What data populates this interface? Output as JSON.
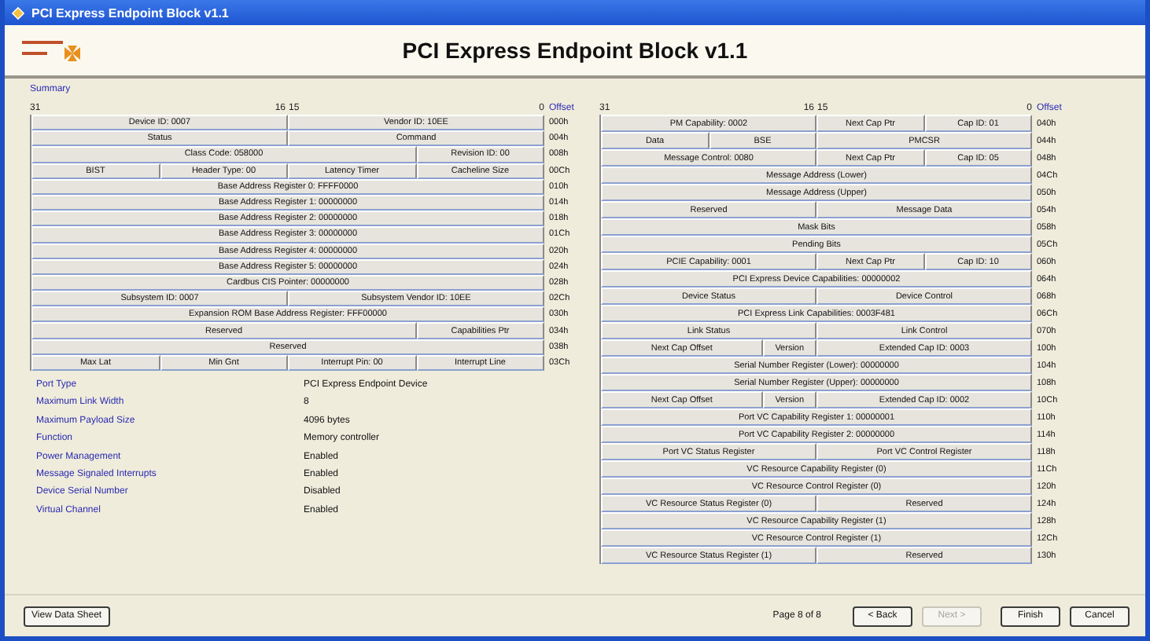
{
  "window": {
    "title": "PCI Express Endpoint Block v1.1"
  },
  "heading": "PCI Express Endpoint Block v1.1",
  "section_label": "Summary",
  "left_table": {
    "bit_headers": [
      "31",
      "16",
      "15",
      "0"
    ],
    "offset_header": "Offset",
    "rows": [
      {
        "offset": "000h",
        "cells": [
          {
            "label": "Device ID: 0007",
            "kind": "half"
          },
          {
            "label": "Vendor ID: 10EE",
            "kind": "half"
          }
        ]
      },
      {
        "offset": "004h",
        "cells": [
          {
            "label": "Status",
            "kind": "half"
          },
          {
            "label": "Command",
            "kind": "half"
          }
        ]
      },
      {
        "offset": "008h",
        "cells": [
          {
            "label": "Class Code: 058000",
            "kind": "triple"
          },
          {
            "label": "Revision ID: 00",
            "kind": "byte"
          }
        ]
      },
      {
        "offset": "00Ch",
        "cells": [
          {
            "label": "BIST",
            "kind": "byte"
          },
          {
            "label": "Header Type: 00",
            "kind": "byte"
          },
          {
            "label": "Latency Timer",
            "kind": "byte"
          },
          {
            "label": "Cacheline Size",
            "kind": "byte"
          }
        ]
      },
      {
        "offset": "010h",
        "cells": [
          {
            "label": "Base Address Register 0: FFFF0000",
            "kind": "word"
          }
        ]
      },
      {
        "offset": "014h",
        "cells": [
          {
            "label": "Base Address Register 1: 00000000",
            "kind": "word"
          }
        ]
      },
      {
        "offset": "018h",
        "cells": [
          {
            "label": "Base Address Register 2: 00000000",
            "kind": "word"
          }
        ]
      },
      {
        "offset": "01Ch",
        "cells": [
          {
            "label": "Base Address Register 3: 00000000",
            "kind": "word"
          }
        ]
      },
      {
        "offset": "020h",
        "cells": [
          {
            "label": "Base Address Register 4: 00000000",
            "kind": "word"
          }
        ]
      },
      {
        "offset": "024h",
        "cells": [
          {
            "label": "Base Address Register 5: 00000000",
            "kind": "word"
          }
        ]
      },
      {
        "offset": "028h",
        "cells": [
          {
            "label": "Cardbus CIS Pointer: 00000000",
            "kind": "word"
          }
        ]
      },
      {
        "offset": "02Ch",
        "cells": [
          {
            "label": "Subsystem ID: 0007",
            "kind": "half"
          },
          {
            "label": "Subsystem Vendor ID: 10EE",
            "kind": "half"
          }
        ]
      },
      {
        "offset": "030h",
        "cells": [
          {
            "label": "Expansion ROM Base Address Register: FFF00000",
            "kind": "word"
          }
        ]
      },
      {
        "offset": "034h",
        "cells": [
          {
            "label": "Reserved",
            "kind": "triple"
          },
          {
            "label": "Capabilities Ptr",
            "kind": "byte"
          }
        ]
      },
      {
        "offset": "038h",
        "cells": [
          {
            "label": "Reserved",
            "kind": "word"
          }
        ]
      },
      {
        "offset": "03Ch",
        "cells": [
          {
            "label": "Max Lat",
            "kind": "byte"
          },
          {
            "label": "Min Gnt",
            "kind": "byte"
          },
          {
            "label": "Interrupt Pin: 00",
            "kind": "byte"
          },
          {
            "label": "Interrupt Line",
            "kind": "byte"
          }
        ]
      }
    ]
  },
  "properties": [
    {
      "label": "Port Type",
      "value": "PCI Express Endpoint Device"
    },
    {
      "label": "Maximum Link Width",
      "value": "8"
    },
    {
      "label": "Maximum Payload Size",
      "value": "4096 bytes"
    },
    {
      "label": "Function",
      "value": "Memory controller"
    },
    {
      "label": "Power Management",
      "value": "Enabled"
    },
    {
      "label": "Message Signaled Interrupts",
      "value": "Enabled"
    },
    {
      "label": "Device Serial Number",
      "value": "Disabled"
    },
    {
      "label": "Virtual Channel",
      "value": "Enabled"
    }
  ],
  "right_table": {
    "bit_headers": [
      "31",
      "16",
      "15",
      "0"
    ],
    "offset_header": "Offset",
    "rows": [
      {
        "offset": "040h",
        "cells": [
          {
            "label": "PM Capability: 0002",
            "kind": "half"
          },
          {
            "label": "Next Cap Ptr",
            "kind": "byte"
          },
          {
            "label": "Cap ID: 01",
            "kind": "byte"
          }
        ]
      },
      {
        "offset": "044h",
        "cells": [
          {
            "label": "Data",
            "kind": "byte"
          },
          {
            "label": "BSE",
            "kind": "byte"
          },
          {
            "label": "PMCSR",
            "kind": "half"
          }
        ]
      },
      {
        "offset": "048h",
        "cells": [
          {
            "label": "Message Control: 0080",
            "kind": "half"
          },
          {
            "label": "Next Cap Ptr",
            "kind": "byte"
          },
          {
            "label": "Cap ID: 05",
            "kind": "byte"
          }
        ]
      },
      {
        "offset": "04Ch",
        "cells": [
          {
            "label": "Message Address (Lower)",
            "kind": "word"
          }
        ]
      },
      {
        "offset": "050h",
        "cells": [
          {
            "label": "Message Address (Upper)",
            "kind": "word"
          }
        ]
      },
      {
        "offset": "054h",
        "cells": [
          {
            "label": "Reserved",
            "kind": "half"
          },
          {
            "label": "Message Data",
            "kind": "half"
          }
        ]
      },
      {
        "offset": "058h",
        "cells": [
          {
            "label": "Mask Bits",
            "kind": "word"
          }
        ]
      },
      {
        "offset": "05Ch",
        "cells": [
          {
            "label": "Pending Bits",
            "kind": "word"
          }
        ]
      },
      {
        "offset": "060h",
        "cells": [
          {
            "label": "PCIE Capability: 0001",
            "kind": "half"
          },
          {
            "label": "Next Cap Ptr",
            "kind": "byte"
          },
          {
            "label": "Cap ID: 10",
            "kind": "byte"
          }
        ]
      },
      {
        "offset": "064h",
        "cells": [
          {
            "label": "PCI Express Device Capabilities: 00000002",
            "kind": "word"
          }
        ]
      },
      {
        "offset": "068h",
        "cells": [
          {
            "label": "Device Status",
            "kind": "half"
          },
          {
            "label": "Device Control",
            "kind": "half"
          }
        ]
      },
      {
        "offset": "06Ch",
        "cells": [
          {
            "label": "PCI Express Link Capabilities: 0003F481",
            "kind": "word"
          }
        ]
      },
      {
        "offset": "070h",
        "cells": [
          {
            "label": "Link Status",
            "kind": "half"
          },
          {
            "label": "Link Control",
            "kind": "half"
          }
        ]
      },
      {
        "offset": "100h",
        "cells": [
          {
            "label": "Next Cap Offset",
            "kind": "twelve"
          },
          {
            "label": "Version",
            "kind": "nibble"
          },
          {
            "label": "Extended Cap ID: 0003",
            "kind": "half"
          }
        ]
      },
      {
        "offset": "104h",
        "cells": [
          {
            "label": "Serial Number Register (Lower): 00000000",
            "kind": "word"
          }
        ]
      },
      {
        "offset": "108h",
        "cells": [
          {
            "label": "Serial Number Register (Upper): 00000000",
            "kind": "word"
          }
        ]
      },
      {
        "offset": "10Ch",
        "cells": [
          {
            "label": "Next Cap Offset",
            "kind": "twelve"
          },
          {
            "label": "Version",
            "kind": "nibble"
          },
          {
            "label": "Extended Cap ID: 0002",
            "kind": "half"
          }
        ]
      },
      {
        "offset": "110h",
        "cells": [
          {
            "label": "Port VC Capability Register 1: 00000001",
            "kind": "word"
          }
        ]
      },
      {
        "offset": "114h",
        "cells": [
          {
            "label": "Port VC Capability Register 2: 00000000",
            "kind": "word"
          }
        ]
      },
      {
        "offset": "118h",
        "cells": [
          {
            "label": "Port VC Status Register",
            "kind": "half"
          },
          {
            "label": "Port VC Control Register",
            "kind": "half"
          }
        ]
      },
      {
        "offset": "11Ch",
        "cells": [
          {
            "label": "VC Resource Capability Register (0)",
            "kind": "word"
          }
        ]
      },
      {
        "offset": "120h",
        "cells": [
          {
            "label": "VC Resource Control Register (0)",
            "kind": "word"
          }
        ]
      },
      {
        "offset": "124h",
        "cells": [
          {
            "label": "VC Resource Status Register (0)",
            "kind": "half"
          },
          {
            "label": "Reserved",
            "kind": "half"
          }
        ]
      },
      {
        "offset": "128h",
        "cells": [
          {
            "label": "VC Resource Capability Register (1)",
            "kind": "word"
          }
        ]
      },
      {
        "offset": "12Ch",
        "cells": [
          {
            "label": "VC Resource Control Register (1)",
            "kind": "word"
          }
        ]
      },
      {
        "offset": "130h",
        "cells": [
          {
            "label": "VC Resource Status Register (1)",
            "kind": "half"
          },
          {
            "label": "Reserved",
            "kind": "half"
          }
        ]
      }
    ]
  },
  "footer": {
    "datasheet_button": "View Data Sheet",
    "page_indicator": "Page 8 of 8",
    "buttons": [
      {
        "label": "< Back",
        "disabled": false
      },
      {
        "label": "Next >",
        "disabled": true
      },
      {
        "label": "Finish",
        "disabled": false
      },
      {
        "label": "Cancel",
        "disabled": false
      }
    ]
  }
}
